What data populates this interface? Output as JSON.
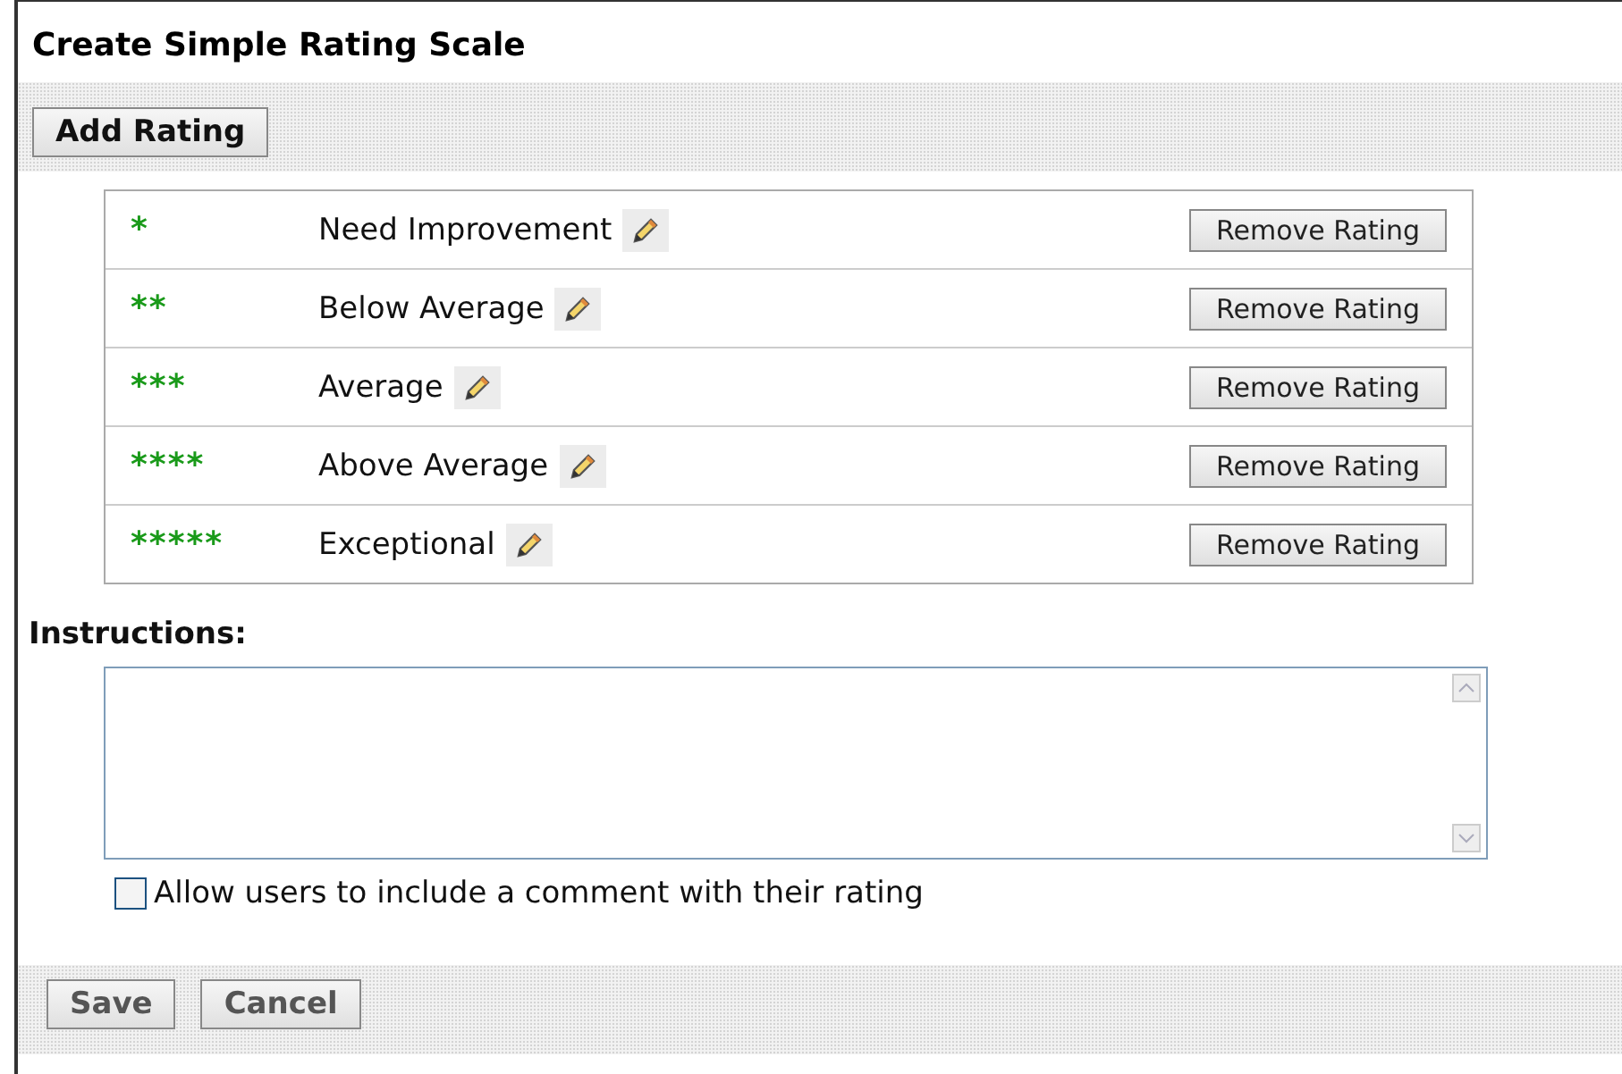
{
  "title": "Create Simple Rating Scale",
  "toolbar": {
    "add_button": "Add Rating"
  },
  "ratings": [
    {
      "marker": "*",
      "label": "Need Improvement",
      "remove_button": "Remove Rating"
    },
    {
      "marker": "**",
      "label": "Below Average",
      "remove_button": "Remove Rating"
    },
    {
      "marker": "***",
      "label": "Average",
      "remove_button": "Remove Rating"
    },
    {
      "marker": "****",
      "label": "Above Average",
      "remove_button": "Remove Rating"
    },
    {
      "marker": "*****",
      "label": "Exceptional",
      "remove_button": "Remove Rating"
    }
  ],
  "instructions": {
    "label": "Instructions:"
  },
  "allow_comment": {
    "label": "Allow users to include a comment with their rating",
    "checked": false
  },
  "buttons": [
    "Save",
    "Cancel"
  ]
}
